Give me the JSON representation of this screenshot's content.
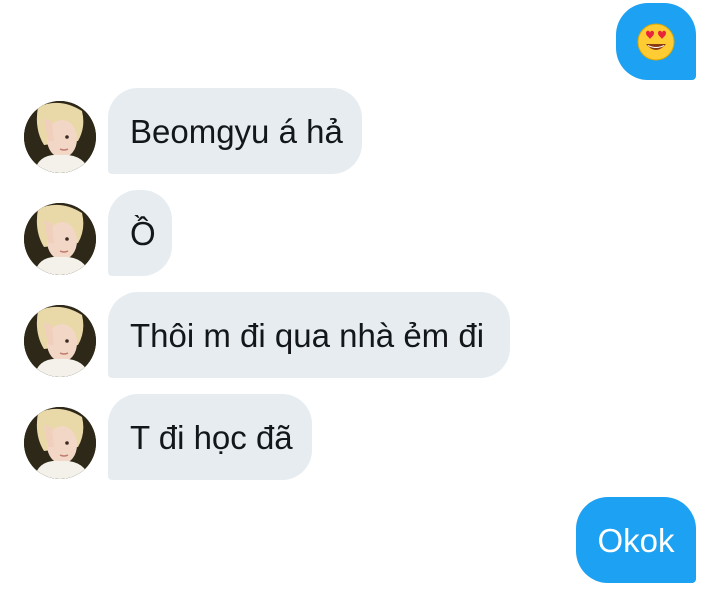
{
  "messages": [
    {
      "side": "sent",
      "kind": "emoji",
      "emoji": "smiling-face-with-heart-eyes"
    },
    {
      "side": "received",
      "text": "Beomgyu á hả"
    },
    {
      "side": "received",
      "text": "Ồ"
    },
    {
      "side": "received",
      "text": "Thôi m đi qua nhà ẻm đi"
    },
    {
      "side": "received",
      "text": "T đi học đã"
    },
    {
      "side": "sent",
      "text": "Okok"
    }
  ],
  "colors": {
    "sent_bubble": "#1da1f2",
    "received_bubble": "#e6ecf0",
    "received_text": "#14171a",
    "sent_text": "#ffffff"
  }
}
